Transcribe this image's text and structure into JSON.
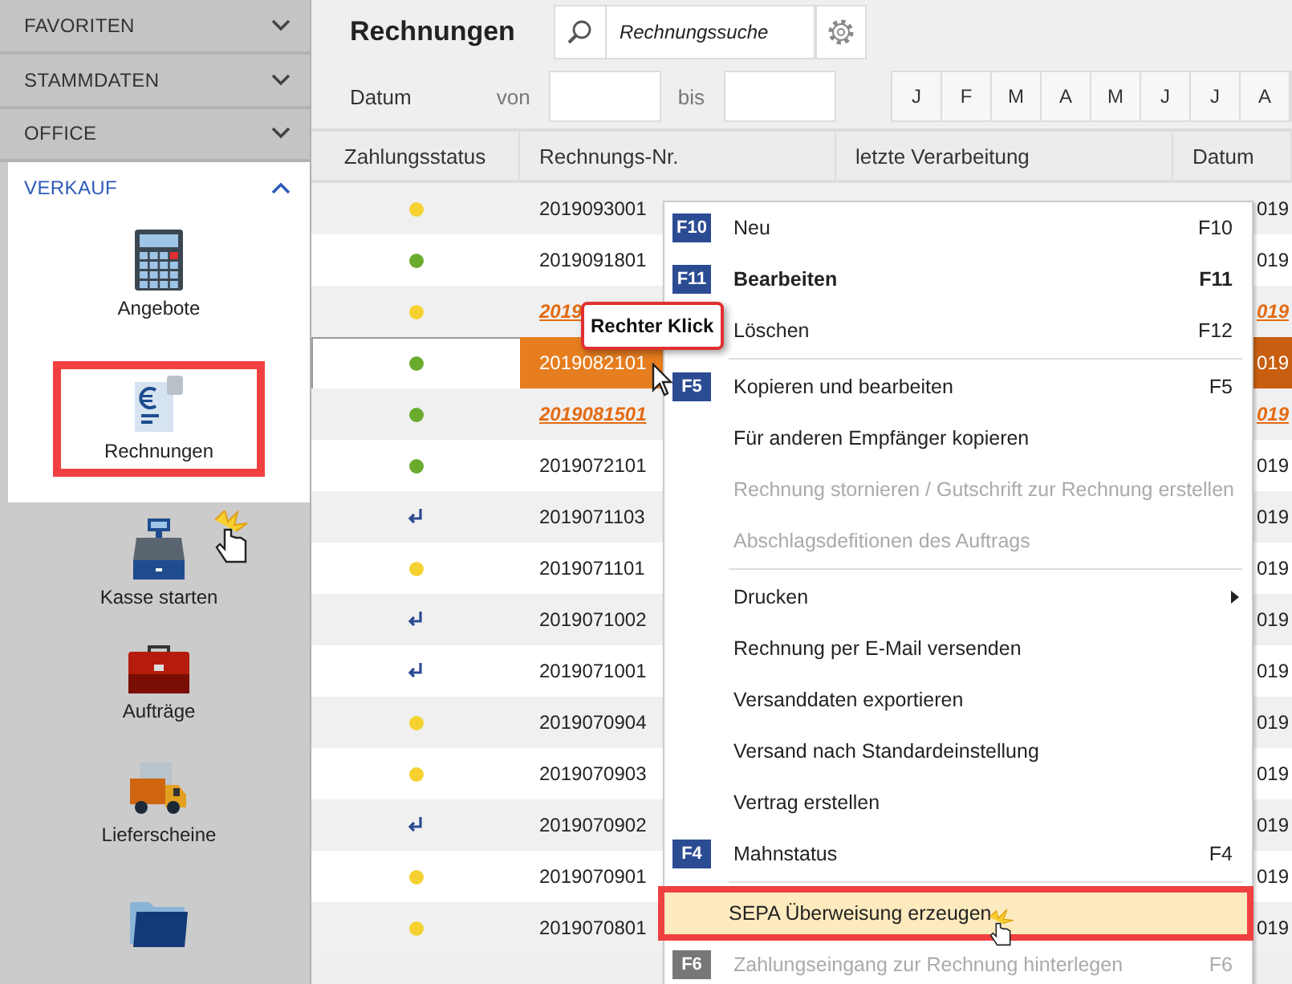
{
  "sidebar": {
    "sections": [
      {
        "label": "FAVORITEN",
        "expanded": false
      },
      {
        "label": "STAMMDATEN",
        "expanded": false
      },
      {
        "label": "OFFICE",
        "expanded": false
      },
      {
        "label": "VERKAUF",
        "expanded": true,
        "items": [
          {
            "kind": "calculator",
            "label": "Angebote",
            "spotlight": true,
            "selected": false
          },
          {
            "kind": "invoice",
            "label": "Rechnungen",
            "spotlight": true,
            "selected": true
          },
          {
            "kind": "register",
            "label": "Kasse starten",
            "spotlight": false,
            "selected": false
          },
          {
            "kind": "briefcase",
            "label": "Aufträge",
            "spotlight": false,
            "selected": false
          },
          {
            "kind": "truck",
            "label": "Lieferscheine",
            "spotlight": false,
            "selected": false
          },
          {
            "kind": "folder",
            "spotlight": false,
            "selected": false
          }
        ]
      }
    ]
  },
  "header": {
    "title": "Rechnungen",
    "search": {
      "placeholder": "Rechnungssuche"
    }
  },
  "filter": {
    "label": "Datum",
    "from_label": "von",
    "to_label": "bis",
    "months": [
      "J",
      "F",
      "M",
      "A",
      "M",
      "J",
      "J",
      "A"
    ]
  },
  "table": {
    "columns": [
      "Zahlungsstatus",
      "Rechnungs-Nr.",
      "letzte Verarbeitung",
      "Datum"
    ],
    "rows": [
      {
        "status": {
          "kind": "dot",
          "color": "#f5d130"
        },
        "number": "2019093001",
        "date": "019",
        "highlighted": false,
        "selected": false
      },
      {
        "status": {
          "kind": "dot",
          "color": "#6aab2e"
        },
        "number": "2019091801",
        "date": "019",
        "highlighted": false,
        "selected": false
      },
      {
        "status": {
          "kind": "dot",
          "color": "#f5d130"
        },
        "number": "2019",
        "date": "019",
        "highlighted": true,
        "selected": false
      },
      {
        "status": {
          "kind": "dot",
          "color": "#6aab2e"
        },
        "number": "2019082101",
        "date": "019",
        "highlighted": false,
        "selected": true
      },
      {
        "status": {
          "kind": "dot",
          "color": "#6aab2e"
        },
        "number": "2019081501",
        "date": "019",
        "highlighted": true,
        "selected": false
      },
      {
        "status": {
          "kind": "dot",
          "color": "#6aab2e"
        },
        "number": "2019072101",
        "date": "019",
        "highlighted": false,
        "selected": false
      },
      {
        "status": {
          "kind": "return"
        },
        "number": "2019071103",
        "date": "019",
        "highlighted": false,
        "selected": false
      },
      {
        "status": {
          "kind": "dot",
          "color": "#f5d130"
        },
        "number": "2019071101",
        "date": "019",
        "highlighted": false,
        "selected": false
      },
      {
        "status": {
          "kind": "return"
        },
        "number": "2019071002",
        "date": "019",
        "highlighted": false,
        "selected": false
      },
      {
        "status": {
          "kind": "return"
        },
        "number": "2019071001",
        "date": "019",
        "highlighted": false,
        "selected": false
      },
      {
        "status": {
          "kind": "dot",
          "color": "#f5d130"
        },
        "number": "2019070904",
        "date": "019",
        "highlighted": false,
        "selected": false
      },
      {
        "status": {
          "kind": "dot",
          "color": "#f5d130"
        },
        "number": "2019070903",
        "date": "019",
        "highlighted": false,
        "selected": false
      },
      {
        "status": {
          "kind": "return"
        },
        "number": "2019070902",
        "date": "019",
        "highlighted": false,
        "selected": false
      },
      {
        "status": {
          "kind": "dot",
          "color": "#f5d130"
        },
        "number": "2019070901",
        "date": "019",
        "highlighted": false,
        "selected": false
      },
      {
        "status": {
          "kind": "dot",
          "color": "#f5d130"
        },
        "number": "2019070801",
        "date": "019",
        "highlighted": false,
        "selected": false
      }
    ]
  },
  "tooltip": {
    "text": "Rechter Klick"
  },
  "context_menu": {
    "items": [
      {
        "key": "F10",
        "label": "Neu",
        "shortcut": "F10",
        "bold": false,
        "disabled": false,
        "separator_before": false,
        "selected": false
      },
      {
        "key": "F11",
        "label": "Bearbeiten",
        "shortcut": "F11",
        "bold": true,
        "disabled": false,
        "separator_before": false,
        "selected": false
      },
      {
        "label": "Löschen",
        "shortcut": "F12",
        "bold": false,
        "disabled": false,
        "separator_before": false,
        "selected": false
      },
      {
        "key": "F5",
        "label": "Kopieren und bearbeiten",
        "shortcut": "F5",
        "bold": false,
        "disabled": false,
        "separator_before": true,
        "selected": false
      },
      {
        "label": "Für anderen Empfänger kopieren",
        "bold": false,
        "disabled": false,
        "separator_before": false,
        "selected": false
      },
      {
        "label": "Rechnung stornieren / Gutschrift zur Rechnung erstellen",
        "bold": false,
        "disabled": true,
        "separator_before": false,
        "selected": false
      },
      {
        "label": "Abschlagsdefitionen des Auftrags",
        "bold": false,
        "disabled": true,
        "separator_before": false,
        "selected": false
      },
      {
        "label": "Drucken",
        "submenu": true,
        "bold": false,
        "disabled": false,
        "separator_before": true,
        "selected": false
      },
      {
        "label": "Rechnung per E-Mail versenden",
        "bold": false,
        "disabled": false,
        "separator_before": false,
        "selected": false
      },
      {
        "label": "Versanddaten exportieren",
        "bold": false,
        "disabled": false,
        "separator_before": false,
        "selected": false
      },
      {
        "label": "Versand nach Standardeinstellung",
        "bold": false,
        "disabled": false,
        "separator_before": false,
        "selected": false
      },
      {
        "label": "Vertrag erstellen",
        "bold": false,
        "disabled": false,
        "separator_before": false,
        "selected": false
      },
      {
        "key": "F4",
        "label": "Mahnstatus",
        "shortcut": "F4",
        "bold": false,
        "disabled": false,
        "separator_before": false,
        "selected": false
      },
      {
        "label": "SEPA Überweisung erzeugen",
        "bold": false,
        "disabled": false,
        "separator_before": true,
        "selected": true
      },
      {
        "key": "F6",
        "label": "Zahlungseingang zur Rechnung hinterlegen",
        "shortcut": "F6",
        "bold": false,
        "disabled": true,
        "separator_before": false,
        "selected": false
      }
    ]
  }
}
